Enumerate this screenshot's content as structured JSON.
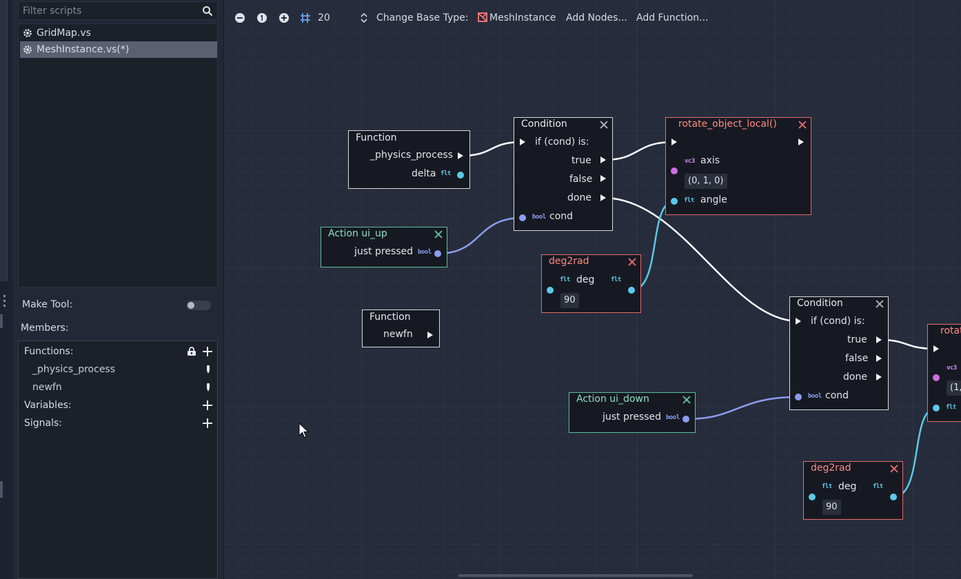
{
  "sidebar": {
    "filter_placeholder": "Filter scripts",
    "scripts": [
      {
        "label": "GridMap.vs",
        "selected": false
      },
      {
        "label": "MeshInstance.vs(*)",
        "selected": true
      }
    ],
    "make_tool_label": "Make Tool:",
    "make_tool_enabled": false,
    "members_label": "Members:",
    "functions_label": "Functions:",
    "functions": [
      "_physics_process",
      "newfn"
    ],
    "variables_label": "Variables:",
    "signals_label": "Signals:"
  },
  "toolbar": {
    "snap_value": "20",
    "change_base_label": "Change Base Type:",
    "base_type": "MeshInstance",
    "add_nodes_label": "Add Nodes...",
    "add_function_label": "Add Function..."
  },
  "nodes": {
    "func1": {
      "title": "Function",
      "out_exec": "_physics_process",
      "out_arg": "delta",
      "out_arg_type": "flt"
    },
    "cond1": {
      "title": "Condition",
      "in_exec": "if (cond) is:",
      "true": "true",
      "false": "false",
      "done": "done",
      "cond": "cond",
      "cond_type": "bool"
    },
    "rotate1": {
      "title": "rotate_object_local()",
      "axis": "axis",
      "axis_type": "vc3",
      "axis_value": "(0, 1, 0)",
      "angle": "angle",
      "angle_type": "flt"
    },
    "action_up": {
      "title": "Action ui_up",
      "out": "just pressed",
      "out_type": "bool"
    },
    "deg2rad1": {
      "title": "deg2rad",
      "in": "deg",
      "in_type": "flt",
      "out_type": "flt",
      "value": "90"
    },
    "func2": {
      "title": "Function",
      "out_exec": "newfn"
    },
    "cond2": {
      "title": "Condition",
      "in_exec": "if (cond) is:",
      "true": "true",
      "false": "false",
      "done": "done",
      "cond": "cond",
      "cond_type": "bool"
    },
    "rotate2": {
      "title": "rotat",
      "axis_type": "vc3",
      "axis_value": "(1,",
      "angle_type": "flt"
    },
    "action_down": {
      "title": "Action ui_down",
      "out": "just pressed",
      "out_type": "bool"
    },
    "deg2rad2": {
      "title": "deg2rad",
      "in": "deg",
      "in_type": "flt",
      "out_type": "flt",
      "value": "90"
    }
  },
  "colors": {
    "exec_wire": "#ffffff",
    "float_wire": "#5cc9e8",
    "bool_wire": "#8b9df0",
    "vec3_port": "#d06ee0",
    "function_border": "#d8d8d8",
    "builtin_border": "#e56b6b",
    "action_border": "#5fbf9a"
  }
}
